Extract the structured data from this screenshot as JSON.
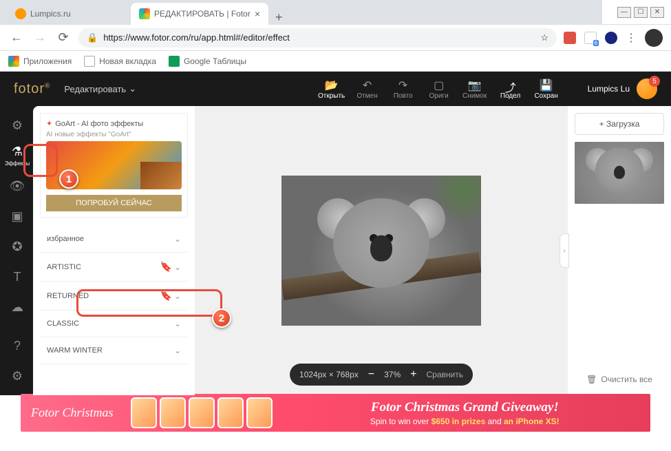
{
  "window": {
    "minimize": "—",
    "maximize": "☐",
    "close": "✕"
  },
  "tabs": {
    "inactive": {
      "title": "Lumpics.ru"
    },
    "active": {
      "title": "РЕДАКТИРОВАТЬ | Fotor",
      "close": "×"
    },
    "new": "+"
  },
  "addr": {
    "url": "https://www.fotor.com/ru/app.html#/editor/effect",
    "star": "☆"
  },
  "bookmarks": {
    "apps": "Приложения",
    "newtab": "Новая вкладка",
    "sheets": "Google Таблицы"
  },
  "header": {
    "logo": "fotor",
    "reg": "®",
    "edit": "Редактировать",
    "chevron": "⌄",
    "tools": {
      "open": "Открыть",
      "undo": "Отмен",
      "redo": "Повто",
      "original": "Ориги",
      "snapshot": "Снимок",
      "share": "Подел",
      "save": "Сохран"
    },
    "user": "Lumpics Lu",
    "badge": "5"
  },
  "rail": {
    "effects": "Эффекты"
  },
  "panel": {
    "goart_title": "GoArt - AI фото эффекты",
    "goart_sub": "AI новые эффекты \"GoArt\"",
    "try": "ПОПРОБУЙ СЕЙЧАС",
    "favorites": "избранное",
    "artistic": "ARTISTIC",
    "returned": "RETURNED",
    "classic": "CLASSIC",
    "warm": "WARM WINTER"
  },
  "canvas": {
    "dims": "1024px × 768px",
    "minus": "−",
    "pct": "37%",
    "plus": "+",
    "compare": "Сравнить",
    "expand": "›"
  },
  "right": {
    "upload": "+ Загрузка",
    "clear": "Очистить все",
    "trash": "🗑"
  },
  "anno": {
    "one": "1",
    "two": "2"
  },
  "banner": {
    "left": "Fotor Christmas",
    "title": "Fotor Christmas Grand Giveaway!",
    "sub_a": "Spin to win over ",
    "sub_b": "$650 in prizes",
    "sub_c": " and ",
    "sub_d": "an iPhone XS!"
  }
}
